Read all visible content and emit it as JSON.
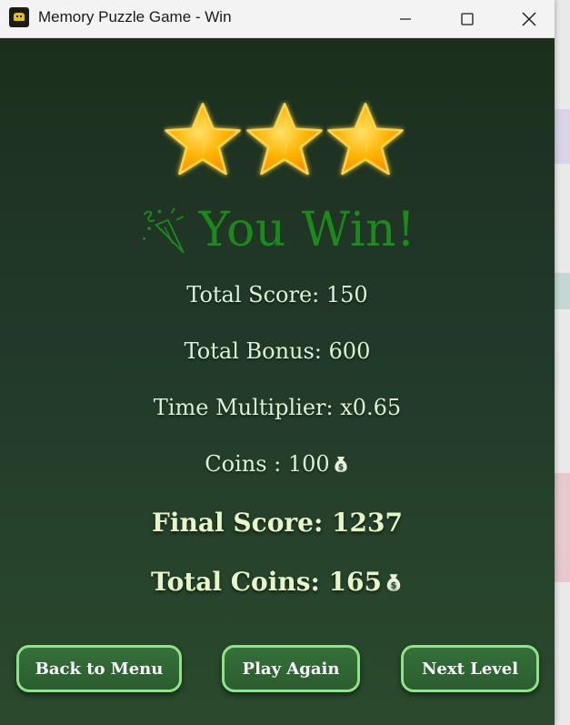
{
  "window": {
    "title": "Memory Puzzle Game - Win"
  },
  "result": {
    "stars_earned": 3,
    "stars_total": 3,
    "heading": "You Win!",
    "heading_color": "#1a8a1a"
  },
  "stats": {
    "total_score": "Total Score: 150",
    "total_bonus": "Total Bonus: 600",
    "time_multiplier": "Time Multiplier: x0.65",
    "coins": "Coins : 100",
    "final_score": "Final Score: 1237",
    "total_coins": "Total Coins: 165"
  },
  "buttons": {
    "back_to_menu": "Back to Menu",
    "play_again": "Play Again",
    "next_level": "Next Level"
  },
  "icons": {
    "app": "game-controller-icon",
    "stars": "star-icon",
    "celebration": "party-popper-icon",
    "coins": "money-bag-icon"
  },
  "colors": {
    "background": "#22392a",
    "text": "#dbf3d4",
    "button_fill": "#2f6434",
    "button_border": "#8fe28a",
    "star": "#ffb300"
  }
}
